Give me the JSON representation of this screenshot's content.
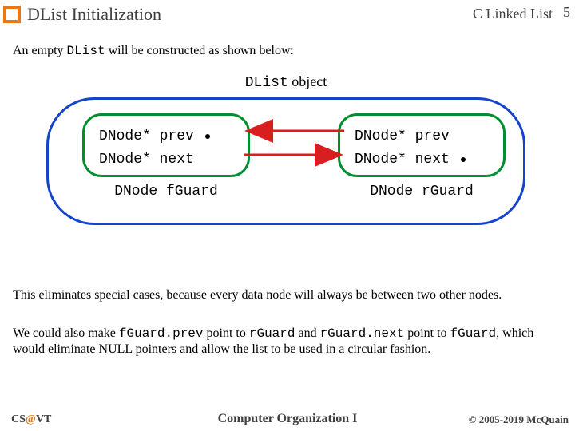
{
  "header": {
    "title": "DList Initialization",
    "course": "C Linked List",
    "page_number": "5"
  },
  "intro": {
    "pre": "An empty ",
    "code": "DList",
    "post": " will be constructed as shown below:"
  },
  "diagram": {
    "title_code": "DList",
    "title_rest": " object",
    "left": {
      "line1": "DNode* prev",
      "line2": "DNode* next",
      "label": "DNode fGuard"
    },
    "right": {
      "line1": "DNode* prev",
      "line2": "DNode* next",
      "label": "DNode rGuard"
    }
  },
  "para1": "This eliminates special cases, because every data node will always be between two other nodes.",
  "para2": {
    "a": "We could also make ",
    "c1": "fGuard.prev",
    "b": " point to ",
    "c2": "rGuard",
    "c": " and ",
    "c3": "rGuard.next",
    "d": " point to ",
    "c4": "fGuard",
    "e": ", which would eliminate NULL pointers and allow the list to be used in a circular fashion."
  },
  "footer": {
    "left_cs": "CS",
    "left_at": "@",
    "left_vt": "VT",
    "center": "Computer Organization I",
    "right": "© 2005-2019 McQuain"
  }
}
